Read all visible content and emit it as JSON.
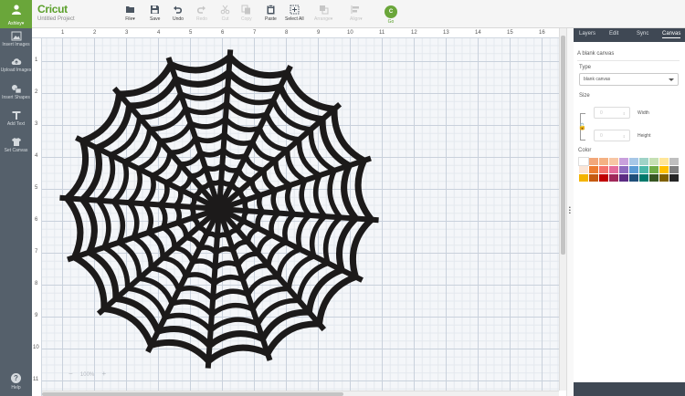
{
  "sidebar": {
    "user_name": "Ashley▾",
    "items": [
      {
        "label": "Insert Images",
        "icon": "image-icon"
      },
      {
        "label": "Upload Images",
        "icon": "upload-icon"
      },
      {
        "label": "Insert Shapes",
        "icon": "shapes-icon"
      },
      {
        "label": "Add Text",
        "icon": "text-icon"
      },
      {
        "label": "Set Canvas",
        "icon": "shirt-icon"
      }
    ],
    "help_label": "Help",
    "help_glyph": "?"
  },
  "topbar": {
    "logo": "Cricut",
    "project_name": "Untitled Project",
    "tools": [
      {
        "label": "File▾",
        "icon": "folder-icon",
        "enabled": true
      },
      {
        "label": "Save",
        "icon": "save-icon",
        "enabled": true
      },
      {
        "label": "Undo",
        "icon": "undo-icon",
        "enabled": true
      },
      {
        "label": "Redo",
        "icon": "redo-icon",
        "enabled": false
      },
      {
        "label": "Cut",
        "icon": "cut-icon",
        "enabled": false
      },
      {
        "label": "Copy",
        "icon": "copy-icon",
        "enabled": false
      },
      {
        "label": "Paste",
        "icon": "paste-icon",
        "enabled": true
      },
      {
        "label": "Select All",
        "icon": "select-all-icon",
        "enabled": true
      },
      {
        "label": "Arrange▾",
        "icon": "arrange-icon",
        "enabled": false
      },
      {
        "label": "Align▾",
        "icon": "align-icon",
        "enabled": false
      }
    ],
    "go_glyph": "C",
    "go_label": "Go"
  },
  "canvas": {
    "ruler_top": [
      "1",
      "2",
      "3",
      "4",
      "5",
      "6",
      "7",
      "8",
      "9",
      "10",
      "11",
      "12",
      "13",
      "14",
      "15",
      "16"
    ],
    "ruler_left": [
      "1",
      "2",
      "3",
      "4",
      "5",
      "6",
      "7",
      "8",
      "9",
      "10",
      "11"
    ],
    "zoom_out": "−",
    "zoom_level": "100%",
    "zoom_in": "+"
  },
  "panel": {
    "tabs": [
      "Layers",
      "Edit",
      "Sync",
      "Canvas"
    ],
    "active_tab": "Canvas",
    "title": "A blank canvas",
    "type_label": "Type",
    "type_value": "blank canvas",
    "size_label": "Size",
    "width_label": "Width",
    "height_label": "Height",
    "width_value": "0",
    "height_value": "0",
    "color_label": "Color",
    "colors": [
      "#ffffff",
      "#f2a77a",
      "#f4b183",
      "#f7c6a4",
      "#c9a0dc",
      "#a7c7e7",
      "#9fd3c7",
      "#c5e0b4",
      "#ffe699",
      "#bfbfbf",
      "#fbe5d6",
      "#ed7d31",
      "#f4736b",
      "#e46c9b",
      "#8e6bbf",
      "#5b9bd5",
      "#4bb8a9",
      "#70ad47",
      "#ffc000",
      "#7f7f7f",
      "#f4b400",
      "#c55a11",
      "#c00000",
      "#a0285a",
      "#5b2c83",
      "#1f4e79",
      "#00796b",
      "#375623",
      "#7f6000",
      "#262626"
    ]
  }
}
